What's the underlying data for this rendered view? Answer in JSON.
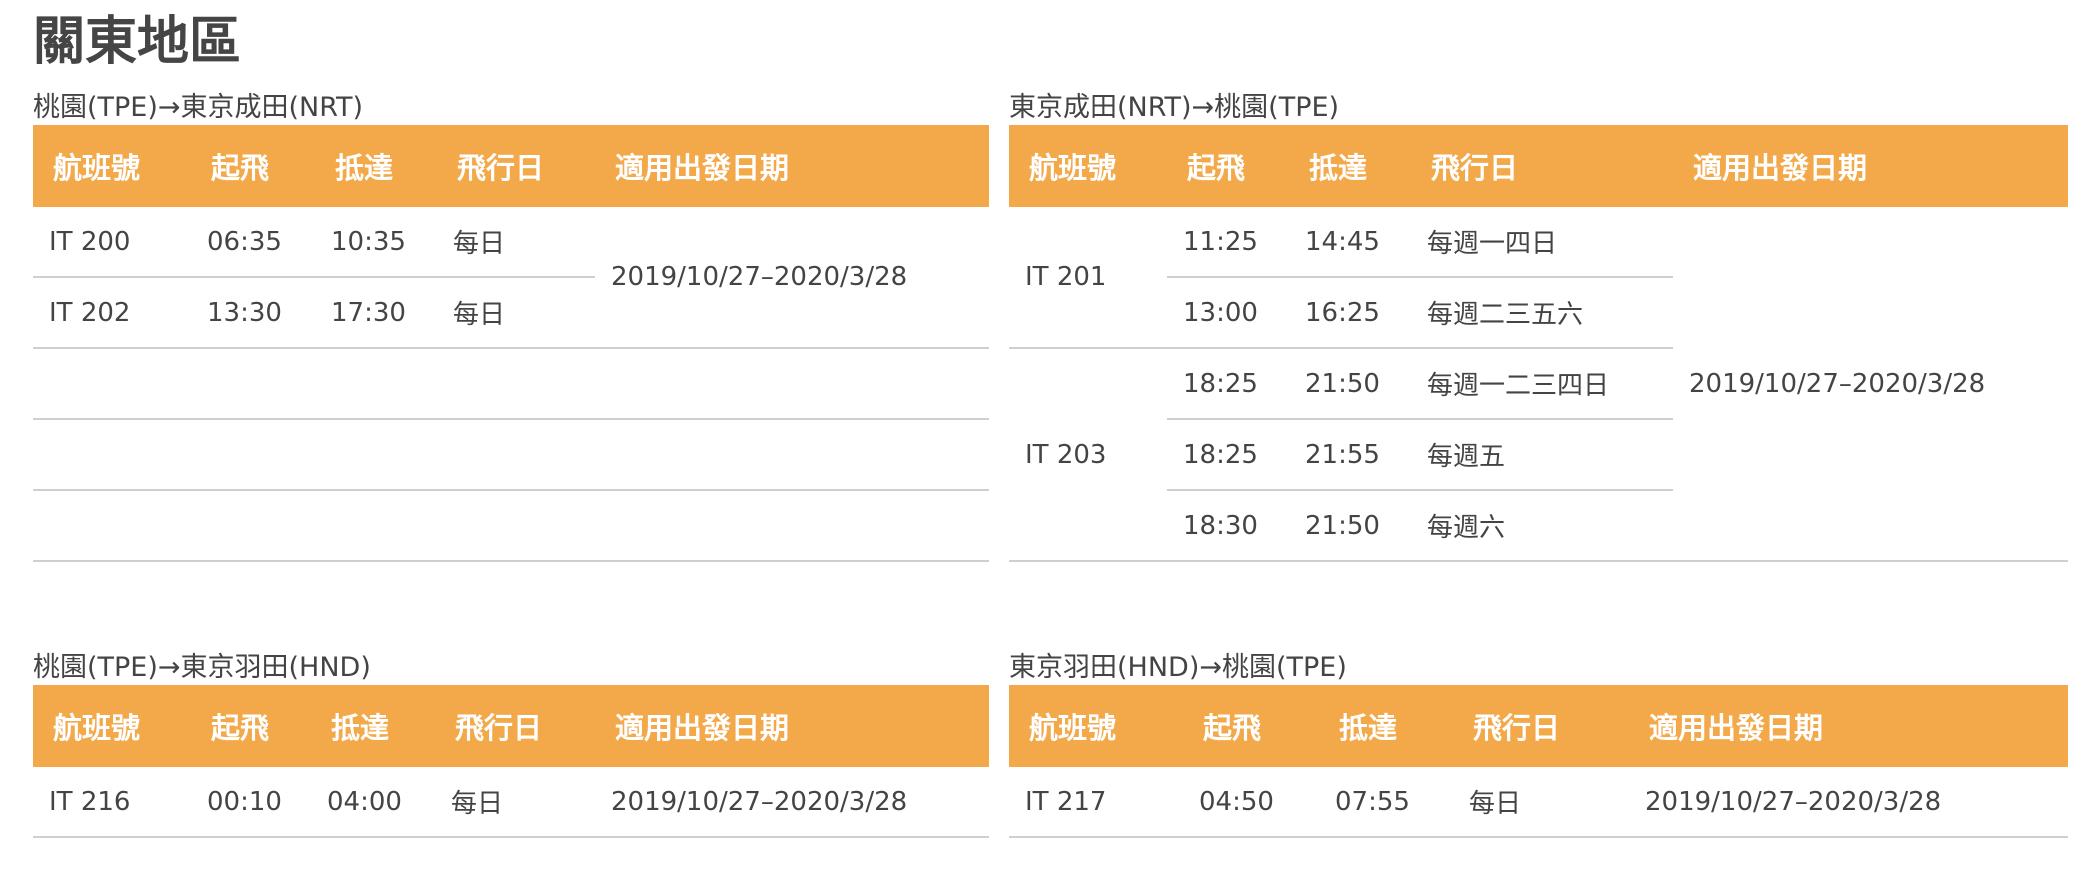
{
  "page_title": "關東地區",
  "headers": [
    "航班號",
    "起飛",
    "抵達",
    "飛行日",
    "適用出發日期"
  ],
  "sections": {
    "tpe_nrt": {
      "route": "桃園(TPE)→東京成田(NRT)",
      "period": "2019/10/27–2020/3/28",
      "rows": [
        {
          "flight": "IT 200",
          "dep": "06:35",
          "arr": "10:35",
          "days": "每日"
        },
        {
          "flight": "IT 202",
          "dep": "13:30",
          "arr": "17:30",
          "days": "每日"
        }
      ]
    },
    "nrt_tpe": {
      "route": "東京成田(NRT)→桃園(TPE)",
      "period": "2019/10/27–2020/3/28",
      "flight_a": "IT 201",
      "flight_b": "IT 203",
      "rows": [
        {
          "dep": "11:25",
          "arr": "14:45",
          "days": "每週一四日"
        },
        {
          "dep": "13:00",
          "arr": "16:25",
          "days": "每週二三五六"
        },
        {
          "dep": "18:25",
          "arr": "21:50",
          "days": "每週一二三四日"
        },
        {
          "dep": "18:25",
          "arr": "21:55",
          "days": "每週五"
        },
        {
          "dep": "18:30",
          "arr": "21:50",
          "days": "每週六"
        }
      ]
    },
    "tpe_hnd": {
      "route": "桃園(TPE)→東京羽田(HND)",
      "rows": [
        {
          "flight": "IT 216",
          "dep": "00:10",
          "arr": "04:00",
          "days": "每日",
          "period": "2019/10/27–2020/3/28"
        }
      ]
    },
    "hnd_tpe": {
      "route": "東京羽田(HND)→桃園(TPE)",
      "rows": [
        {
          "flight": "IT 217",
          "dep": "04:50",
          "arr": "07:55",
          "days": "每日",
          "period": "2019/10/27–2020/3/28"
        }
      ]
    }
  },
  "colors": {
    "header_bg": "#f3a94a",
    "header_text": "#ffffff",
    "divider": "#cfcfcf"
  }
}
